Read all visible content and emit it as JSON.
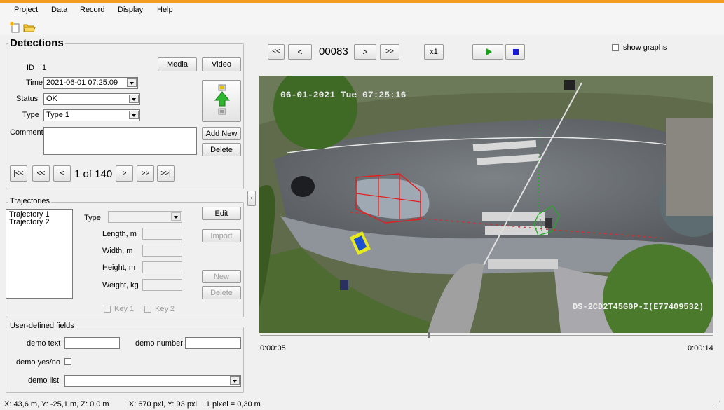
{
  "menu": [
    "Project",
    "Data",
    "Record",
    "Display",
    "Help"
  ],
  "detections": {
    "title": "Detections",
    "id_label": "ID",
    "id_value": "1",
    "time_label": "Time",
    "time_value": "2021-06-01  07:25:09",
    "status_label": "Status",
    "status_value": "OK",
    "type_label": "Type",
    "type_value": "Type 1",
    "comment_label": "Comment",
    "comment_value": "",
    "media_label": "Media",
    "video_label": "Video",
    "add_new_label": "Add New",
    "delete_label": "Delete",
    "nav": {
      "first": "|<<",
      "prev_fast": "<<",
      "prev": "<",
      "counter": "1 of 140",
      "next": ">",
      "next_fast": ">>",
      "last": ">>|"
    }
  },
  "trajectories": {
    "title": "Trajectories",
    "items": [
      "Trajectory 1",
      "Trajectory 2"
    ],
    "type_label": "Type",
    "length_label": "Length, m",
    "width_label": "Width, m",
    "height_label": "Height, m",
    "weight_label": "Weight, kg",
    "edit_label": "Edit",
    "import_label": "Import",
    "new_label": "New",
    "delete_label": "Delete",
    "key1_label": "Key 1",
    "key2_label": "Key 2"
  },
  "user_fields": {
    "title": "User-defined fields",
    "demo_text_label": "demo text",
    "demo_number_label": "demo number",
    "demo_yesno_label": "demo yes/no",
    "demo_list_label": "demo list"
  },
  "player": {
    "first": "<<",
    "prev": "<",
    "frame": "00083",
    "next": ">",
    "last": ">>",
    "speed": "x1",
    "show_graphs_label": "show graphs",
    "time_start": "0:00:05",
    "time_end": "0:00:14",
    "progress": 0.37,
    "overlay_timestamp": "06-01-2021 Tue 07:25:16",
    "overlay_camera": "DS-2CD2T45G0P-I(E77409532)"
  },
  "status": {
    "world_coords": "X: 43,6 m, Y: -25,1 m, Z: 0,0 m",
    "pixel_coords": "|X: 670 pxl, Y: 93 pxl",
    "scale": "|1 pixel = 0,30 m"
  },
  "colors": {
    "accent": "#f39c1f",
    "play": "#1aa11a",
    "stop": "#1a1ad0",
    "bbox": "#e02020",
    "bbox3d": "#22aa22"
  }
}
